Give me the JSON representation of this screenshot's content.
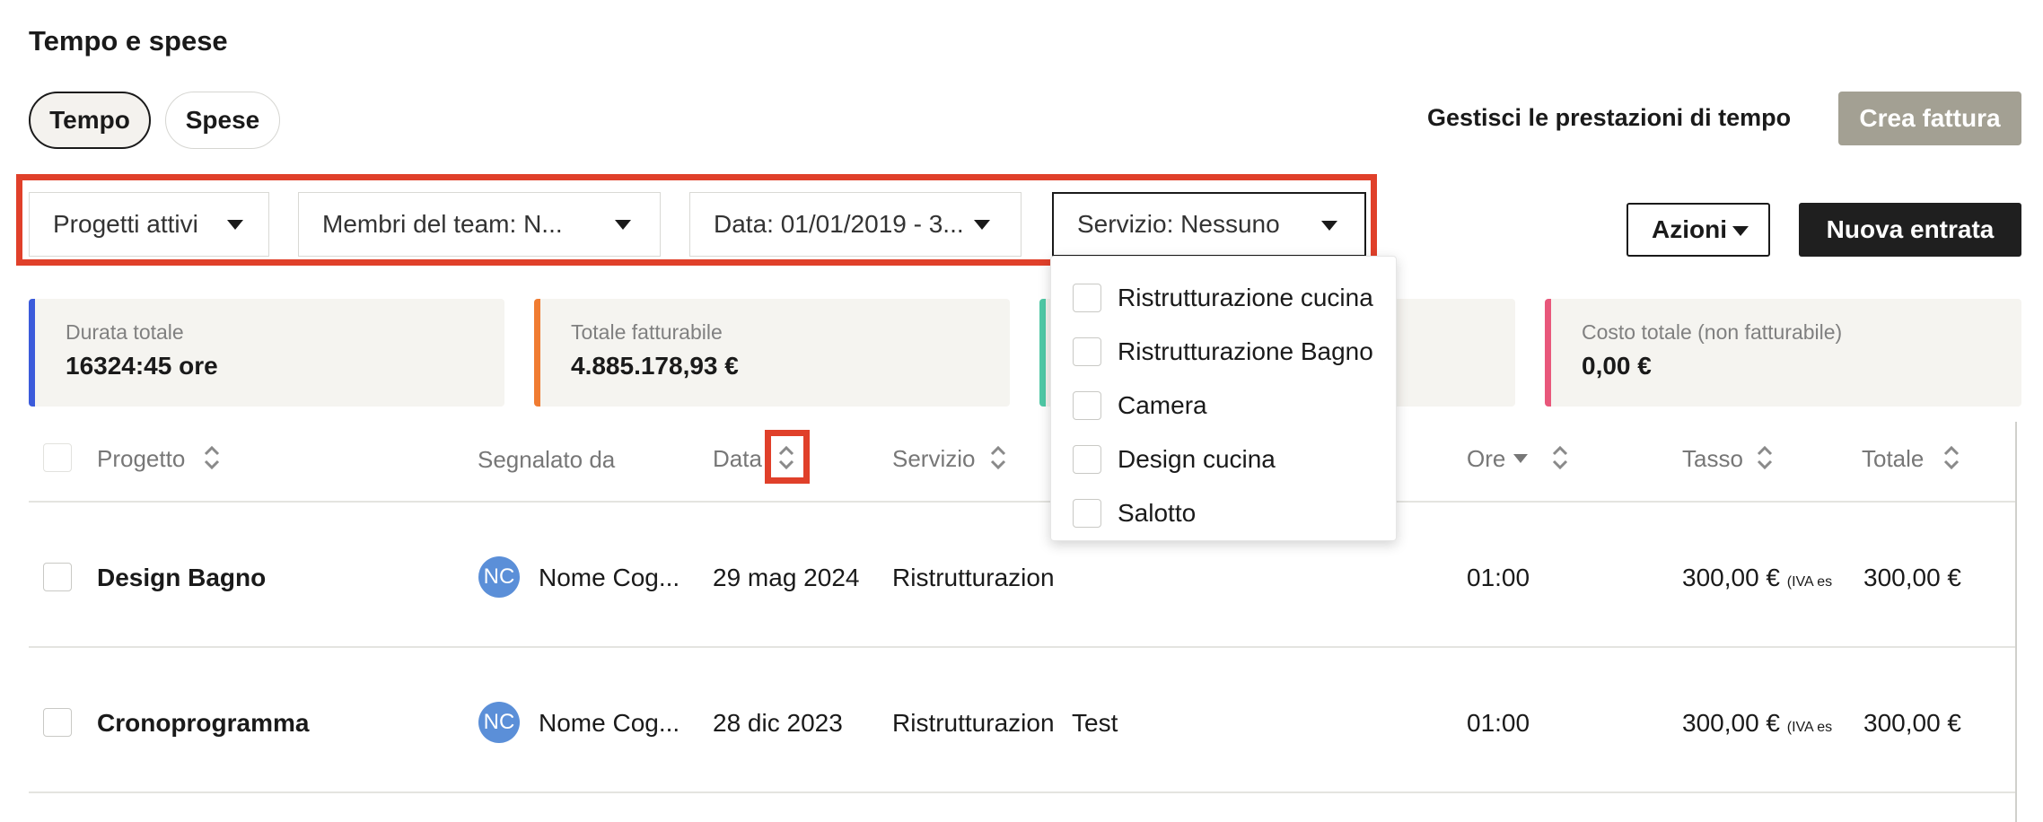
{
  "page": {
    "title": "Tempo e spese"
  },
  "tabs": [
    {
      "label": "Tempo",
      "active": true
    },
    {
      "label": "Spese",
      "active": false
    }
  ],
  "header_actions": {
    "manage_label": "Gestisci le prestazioni di tempo",
    "create_invoice_label": "Crea fattura"
  },
  "filters": {
    "projects": "Progetti attivi",
    "team": "Membri del team: N...",
    "date": "Data: 01/01/2019 - 3...",
    "service": "Servizio: Nessuno"
  },
  "toolbar": {
    "actions_label": "Azioni",
    "new_entry_label": "Nuova entrata"
  },
  "stats": [
    {
      "label": "Durata totale",
      "value": "16324:45 ore",
      "color": "#3b5bdb"
    },
    {
      "label": "Totale fatturabile",
      "value": "4.885.178,93 €",
      "color": "#f07c32"
    },
    {
      "label": "",
      "value": "",
      "color": "#4fc9a6"
    },
    {
      "label": "Costo totale (non fatturabile)",
      "value": "0,00 €",
      "color": "#e8577b"
    }
  ],
  "table": {
    "columns": [
      "Progetto",
      "Segnalato da",
      "Data",
      "Servizio",
      "Ore",
      "Tasso",
      "Totale"
    ],
    "rows": [
      {
        "project": "Design Bagno",
        "initials": "NC",
        "reporter": "Nome Cog...",
        "date": "29 mag 2024",
        "service": "Ristrutturazion",
        "note": "",
        "hours": "01:00",
        "rate": "300,00 €",
        "vat": "(IVA es",
        "total": "300,00 €"
      },
      {
        "project": "Cronoprogramma",
        "initials": "NC",
        "reporter": "Nome Cog...",
        "date": "28 dic 2023",
        "service": "Ristrutturazion",
        "note": "Test",
        "hours": "01:00",
        "rate": "300,00 €",
        "vat": "(IVA es",
        "total": "300,00 €"
      }
    ]
  },
  "service_dropdown": {
    "options": [
      "Ristrutturazione cucina",
      "Ristrutturazione Bagno",
      "Camera",
      "Design cucina",
      "Salotto"
    ]
  },
  "colors": {
    "highlight": "#e0402a",
    "primary_dark": "#1f1f1f",
    "muted_button": "#a3a093",
    "avatar": "#5b8fd8"
  }
}
